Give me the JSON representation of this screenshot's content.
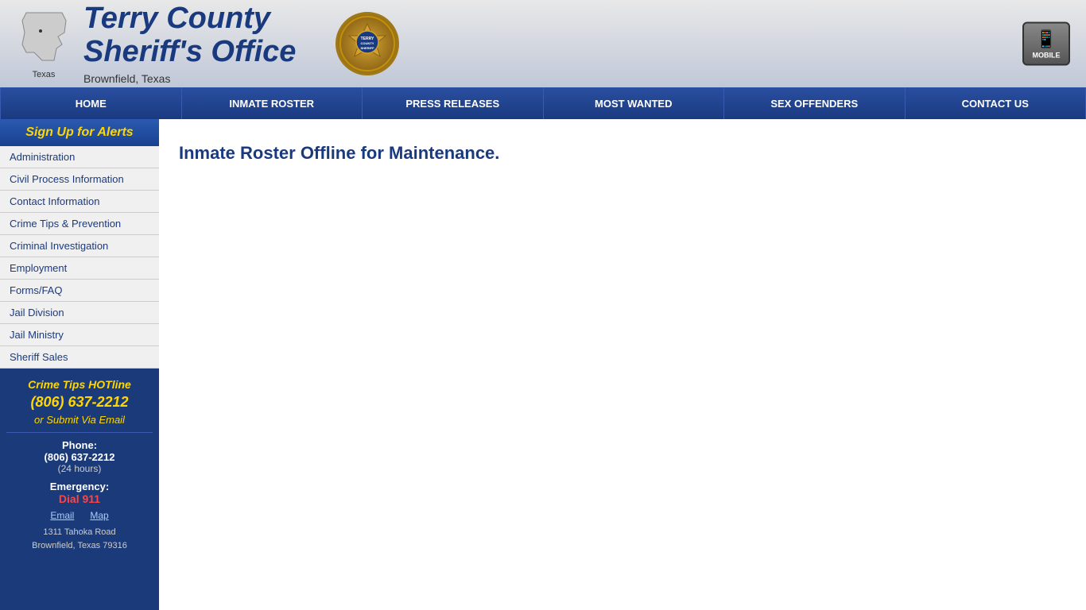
{
  "header": {
    "state_label": "Texas",
    "title_line1": "Terry County",
    "title_line2": "Sheriff's Office",
    "subtitle": "Brownfield, Texas",
    "mobile_label": "MOBILE"
  },
  "navbar": {
    "items": [
      {
        "id": "home",
        "label": "HOME"
      },
      {
        "id": "inmate-roster",
        "label": "INMATE ROSTER"
      },
      {
        "id": "press-releases",
        "label": "PRESS RELEASES"
      },
      {
        "id": "most-wanted",
        "label": "MOST WANTED"
      },
      {
        "id": "sex-offenders",
        "label": "SEX OFFENDERS"
      },
      {
        "id": "contact-us",
        "label": "CONTACT US"
      }
    ]
  },
  "sidebar": {
    "header": "Sign Up for Alerts",
    "nav_items": [
      {
        "id": "administration",
        "label": "Administration"
      },
      {
        "id": "civil-process",
        "label": "Civil Process Information"
      },
      {
        "id": "contact-info",
        "label": "Contact Information"
      },
      {
        "id": "crime-tips",
        "label": "Crime Tips & Prevention"
      },
      {
        "id": "criminal-investigation",
        "label": "Criminal Investigation"
      },
      {
        "id": "employment",
        "label": "Employment"
      },
      {
        "id": "forms-faq",
        "label": "Forms/FAQ"
      },
      {
        "id": "jail-division",
        "label": "Jail Division"
      },
      {
        "id": "jail-ministry",
        "label": "Jail Ministry"
      },
      {
        "id": "sheriff-sales",
        "label": "Sheriff Sales"
      }
    ]
  },
  "sidebar_info": {
    "crime_tips_title": "Crime Tips HOTline",
    "crime_tips_phone": "(806) 637-2212",
    "crime_tips_email": "or Submit Via Email",
    "phone_label": "Phone:",
    "phone_number": "(806) 637-2212",
    "phone_hours": "(24 hours)",
    "emergency_label": "Emergency:",
    "dial_911": "Dial 911",
    "email_link": "Email",
    "map_link": "Map",
    "address_line1": "1311 Tahoka Road",
    "address_line2": "Brownfield, Texas 79316"
  },
  "content": {
    "maintenance_message": "Inmate Roster Offline for Maintenance."
  }
}
